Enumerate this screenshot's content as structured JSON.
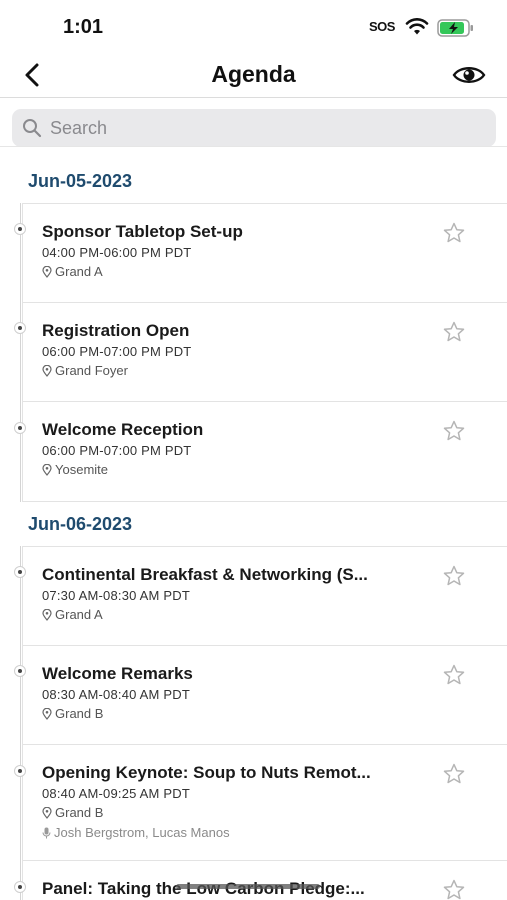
{
  "status_bar": {
    "time": "1:01",
    "sos": "SOS",
    "wifi_icon": "wifi-icon",
    "battery_icon": "battery-charging-icon",
    "battery_color": "#34c759"
  },
  "nav": {
    "back_icon": "chevron-left-icon",
    "title": "Agenda",
    "eye_icon": "eye-icon"
  },
  "search": {
    "placeholder": "Search",
    "value": "",
    "icon": "search-icon"
  },
  "colors": {
    "day_header": "#1f4b6e",
    "star": "#b5b5b5"
  },
  "days": [
    {
      "date": "Jun-05-2023",
      "sessions": [
        {
          "title": "Sponsor Tabletop Set-up",
          "time": "04:00 PM-06:00 PM PDT",
          "location": "Grand A",
          "favorite": false
        },
        {
          "title": "Registration Open",
          "time": "06:00 PM-07:00 PM PDT",
          "location": "Grand Foyer",
          "favorite": false
        },
        {
          "title": "Welcome Reception",
          "time": "06:00 PM-07:00 PM PDT",
          "location": "Yosemite",
          "favorite": false
        }
      ]
    },
    {
      "date": "Jun-06-2023",
      "sessions": [
        {
          "title": "Continental Breakfast & Networking (S...",
          "time": "07:30 AM-08:30 AM PDT",
          "location": "Grand A",
          "favorite": false
        },
        {
          "title": "Welcome Remarks",
          "time": "08:30 AM-08:40 AM PDT",
          "location": "Grand B",
          "favorite": false
        },
        {
          "title": "Opening Keynote: Soup to Nuts Remot...",
          "time": "08:40 AM-09:25 AM PDT",
          "location": "Grand B",
          "speakers": "Josh Bergstrom, Lucas Manos",
          "favorite": false
        },
        {
          "title": "Panel: Taking the Low Carbon Pledge:...",
          "favorite": false
        }
      ]
    }
  ]
}
